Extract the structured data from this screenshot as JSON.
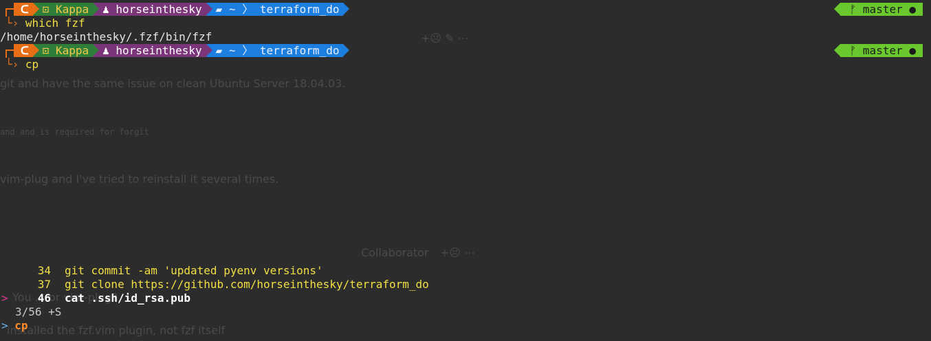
{
  "prompt": {
    "os_icon": "terminal-logo-icon",
    "host": "Kappa",
    "user": "horseinthesky",
    "home": "~",
    "dir": "terraform_do",
    "git_branch": "master"
  },
  "lines": {
    "cmd1": "which fzf",
    "out1": "/home/horseinthesky/.fzf/bin/fzf",
    "cmd2": "cp"
  },
  "ghost": {
    "g1": "git  and have the same issue on clean Ubuntu Server 18.04.03.",
    "g2": "and and is required for forgit",
    "g3": "vim-plug  and I've tried to reinstall it several times.",
    "g4": "Collaborator",
    "g5": "You ... or vim-plug?",
    "g6": "installed the fzf.vim plugin, not fzf itself"
  },
  "fzf": {
    "items": [
      {
        "num": "34",
        "text": "git commit -am 'updated pyenv versions'",
        "selected": false
      },
      {
        "num": "37",
        "text": "git clone https://github.com/horseinthesky/terraform_do",
        "selected": false
      },
      {
        "num": "46",
        "text": "cat .ssh/id_rsa.pub",
        "selected": true
      }
    ],
    "pointer": ">",
    "count": "3/56 +S",
    "prompt_symbol": ">",
    "query": "cp"
  },
  "colors": {
    "background": "#2c2c2c",
    "os_segment": "#e76e15",
    "host_segment": "#2f7f3b",
    "user_segment": "#7b3579",
    "dir_segment": "#1c7fe0",
    "git_segment": "#6ac82e",
    "command": "#f2df43"
  }
}
